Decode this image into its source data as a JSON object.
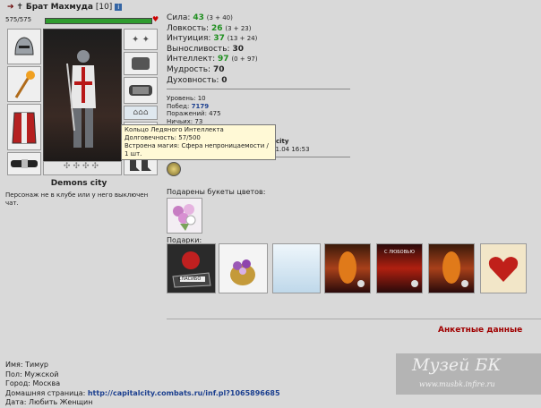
{
  "header": {
    "name": "Брат Махмуда",
    "level": "[10]"
  },
  "hp": {
    "text": "575/575",
    "fraction": 1.0
  },
  "equipment": {
    "left": [
      "helmet-icon",
      "staff-icon",
      "armor-icon",
      "belt-icon"
    ],
    "right": [
      "rings-icon",
      "gloves-icon",
      "bracer-icon",
      "runes-icon",
      "boots-icon"
    ]
  },
  "city": "Demons city",
  "notice": "Персонаж не в клубе или у него выключен чат.",
  "stats": [
    {
      "label": "Сила:",
      "value": "43",
      "extra": "(3 + 40)",
      "color": "green"
    },
    {
      "label": "Ловкость:",
      "value": "26",
      "extra": "(3 + 23)",
      "color": "green"
    },
    {
      "label": "Интуиция:",
      "value": "37",
      "extra": "(13 + 24)",
      "color": "green"
    },
    {
      "label": "Выносливость:",
      "value": "30",
      "extra": "",
      "color": "black"
    },
    {
      "label": "Интеллект:",
      "value": "97",
      "extra": "(0 + 97)",
      "color": "green"
    },
    {
      "label": "Мудрость:",
      "value": "70",
      "extra": "",
      "color": "black"
    },
    {
      "label": "Духовность:",
      "value": "0",
      "extra": "",
      "color": "black"
    }
  ],
  "record": {
    "level_label": "Уровень:",
    "level": "10",
    "wins_label": "Побед:",
    "wins": "7179",
    "losses_label": "Поражений:",
    "losses": "475",
    "draws_label": "Ничьих:",
    "draws": "73",
    "city_tail": "city",
    "birthday": "День рождения персонажа: 16.01.04 16:53"
  },
  "tooltip": {
    "title": "Кольцо Ледяного Интеллекта",
    "durability": "Долговечность: 57/500",
    "magic": "Встроена магия: Сфера непроницаемости / 1 шт."
  },
  "bouquets_label": "Подарены букеты цветов:",
  "gifts_label": "Подарки:",
  "gifts": [
    {
      "icon": "card-icon",
      "caption": "СПАСИБО"
    },
    {
      "icon": "flower-basket-icon",
      "caption": ""
    },
    {
      "icon": "postcard-icon",
      "caption": ""
    },
    {
      "icon": "fire-card-icon",
      "caption": ""
    },
    {
      "icon": "fire-card-icon",
      "caption": "С ЛЮБОВЬЮ"
    },
    {
      "icon": "fire-card-icon",
      "caption": ""
    },
    {
      "icon": "heart-card-icon",
      "caption": ""
    }
  ],
  "anket_title": "Анкетные данные",
  "personal": {
    "name": "Имя: Тимур",
    "gender": "Пол: Мужской",
    "city": "Город: Москва",
    "homepage_label": "Домашняя страница:",
    "homepage": "http://capitalcity.combats.ru/inf.pl?1065896685",
    "partial": "Дата: Любить Женщин"
  },
  "watermark": {
    "title": "Музей БК",
    "url": "www.musbk.infire.ru"
  },
  "colors": {
    "green": "#1f8f1f",
    "link": "#1b3f8f",
    "accent_red": "#a00000",
    "hp": "#2f9c2f"
  }
}
